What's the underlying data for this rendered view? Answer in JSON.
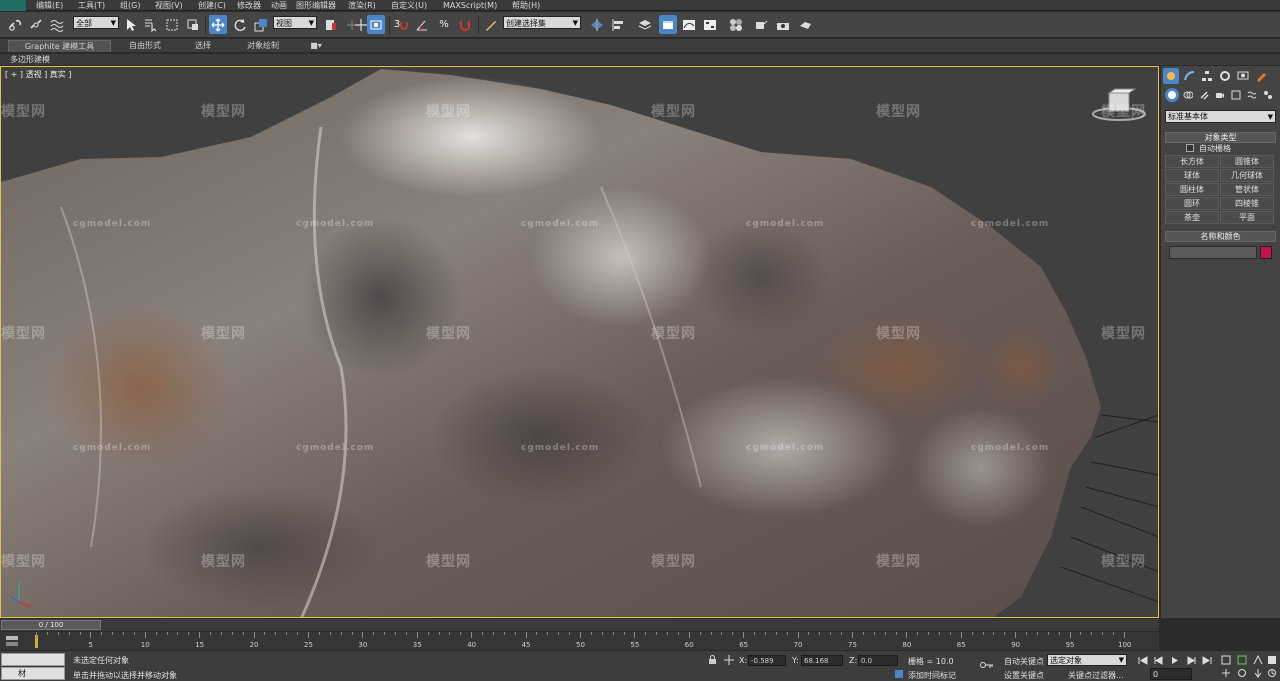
{
  "menu": [
    "编辑(E)",
    "工具(T)",
    "组(G)",
    "视图(V)",
    "创建(C)",
    "修改器",
    "动画",
    "图形编辑器",
    "渲染(R)",
    "自定义(U)",
    "MAXScript(M)",
    "帮助(H)"
  ],
  "toolbar": {
    "filter_select": "全部",
    "ref_coord_select": "视图",
    "snap_label": "3",
    "named_sel_select": "创建选择集"
  },
  "ribbon": {
    "tabs": [
      "Graphite 建模工具",
      "自由形式",
      "选择",
      "对象绘制"
    ],
    "sub_label": "多边形建模"
  },
  "viewport": {
    "label": "[ + ] 透视 ] 真实 ]",
    "watermark_logo": "模型网",
    "watermark_url": "cgmodel.com"
  },
  "command_panel": {
    "category_select": "标准基本体",
    "object_type_header": "对象类型",
    "autogrid_label": "自动栅格",
    "object_buttons": [
      "长方体",
      "圆锥体",
      "球体",
      "几何球体",
      "圆柱体",
      "管状体",
      "圆环",
      "四棱锥",
      "茶壶",
      "平面"
    ],
    "name_color_header": "名称和颜色",
    "object_color": "#c0144a"
  },
  "timeline": {
    "frame_display": "0 / 100",
    "ticks": [
      "5",
      "10",
      "15",
      "20",
      "25",
      "30",
      "35",
      "40",
      "45",
      "50",
      "55",
      "60",
      "65",
      "70",
      "75",
      "80",
      "85",
      "90",
      "95",
      "100"
    ],
    "current_frame_fraction": 0.0
  },
  "status": {
    "selection_text": "未选定任何对象",
    "prompt_text": "单击并拖动以选择并移动对象",
    "x_label": "X:",
    "x_value": "-0.589",
    "y_label": "Y:",
    "y_value": "68.168",
    "z_label": "Z:",
    "z_value": "0.0",
    "grid_text": "栅格 = 10.0",
    "add_time_tag": "添加时间标记",
    "auto_key": "自动关键点",
    "set_key": "设置关键点",
    "key_filter_select": "选定对象",
    "key_filters": "关键点过滤器...",
    "frame_field": "0",
    "left_mini_label": "材"
  }
}
